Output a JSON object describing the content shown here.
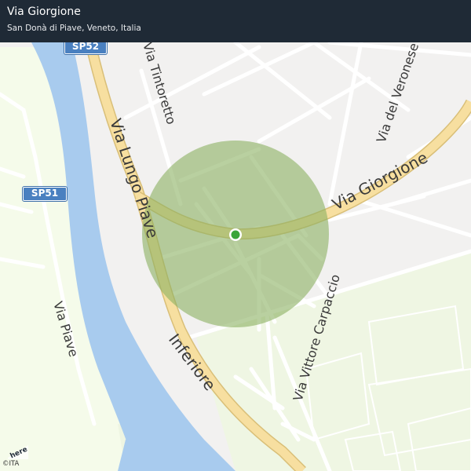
{
  "header": {
    "title": "Via Giorgione",
    "subtitle": "San Donà di Piave, Veneto, Italia"
  },
  "map": {
    "streets": {
      "via_giorgione": "Via Giorgione",
      "via_lungo_piave": "Via Lungo Piave",
      "inferiore": "Inferiore",
      "via_tintoretto": "Via Tintoretto",
      "via_del_veronese": "Via del Veronese",
      "via_vittore_carpaccio": "Via Vittore Carpaccio",
      "via_piave": "Via Piave"
    },
    "shields": {
      "sp52": "SP52",
      "sp51": "SP51"
    },
    "accuracy_circle_color": "#8bb060",
    "location_dot_color": "#3aa53a",
    "river_color": "#a8cbee",
    "primary_road_color": "#f7dfa0"
  },
  "footer": {
    "logo_text": "here",
    "copyright": "©ITA"
  }
}
